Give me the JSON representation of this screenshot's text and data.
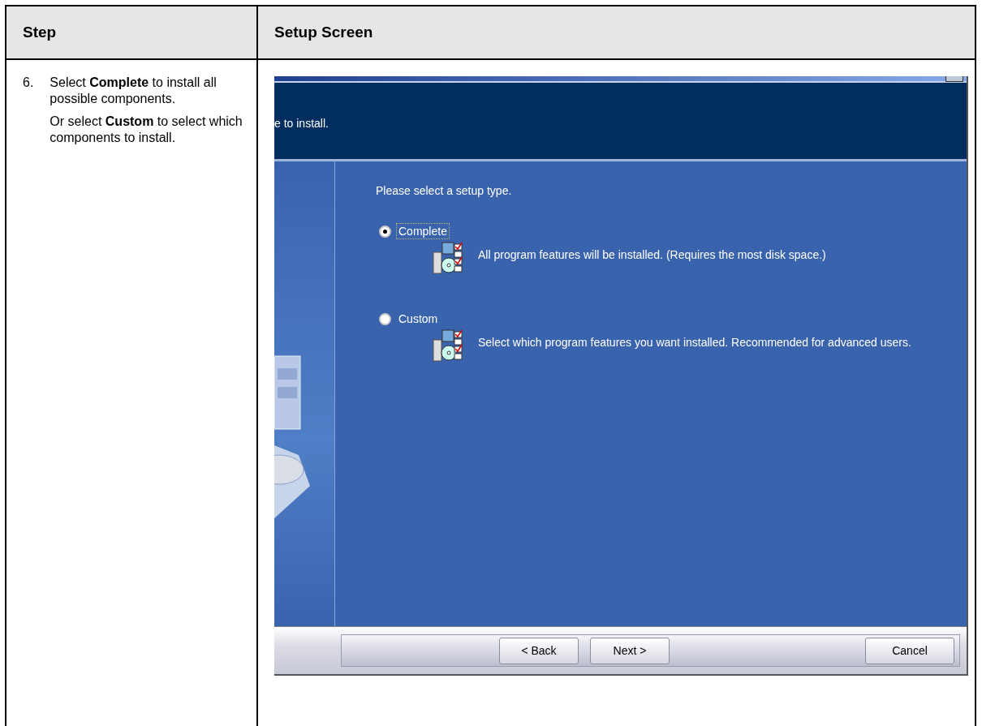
{
  "table": {
    "columns": [
      "Step",
      "Setup Screen"
    ],
    "rows": [
      {
        "step_number": "6.",
        "paragraphs": [
          "Select **Complete** to install all possible components.",
          "Or select **Custom** to select which components to install."
        ],
        "screen": {
          "header_text": "e to install.",
          "prompt": "Please select a setup type.",
          "options": [
            {
              "label": "Complete",
              "description": "All program features will be installed. (Requires the most disk space.)",
              "selected": true
            },
            {
              "label": "Custom",
              "description": "Select which program features you want installed. Recommended for advanced users.",
              "selected": false
            }
          ],
          "buttons": [
            "< Back",
            "Next >",
            "Cancel"
          ]
        }
      }
    ]
  }
}
